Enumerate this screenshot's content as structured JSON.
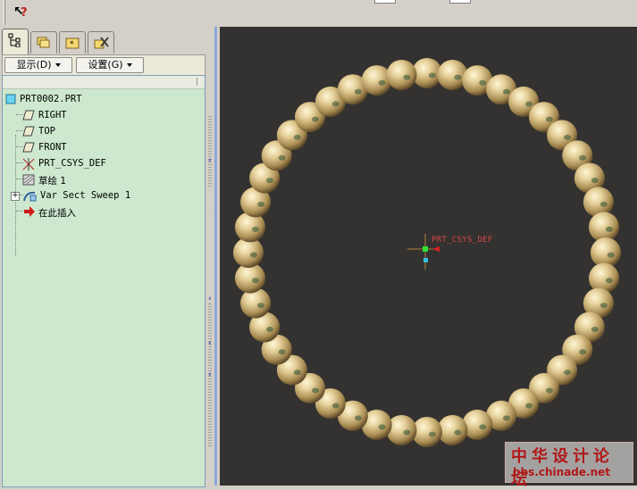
{
  "toolbar": {
    "help_icon": "context-help-icon"
  },
  "tabs": [
    {
      "name": "model-tree-icon",
      "active": true
    },
    {
      "name": "folder-browser-icon",
      "active": false
    },
    {
      "name": "favorites-icon",
      "active": false
    },
    {
      "name": "connections-icon",
      "active": false
    }
  ],
  "buttons": {
    "display_label": "显示(D)",
    "settings_label": "设置(G)"
  },
  "tree": {
    "root": "PRT0002.PRT",
    "items": [
      {
        "label": "RIGHT",
        "icon": "datum-plane-icon"
      },
      {
        "label": "TOP",
        "icon": "datum-plane-icon"
      },
      {
        "label": "FRONT",
        "icon": "datum-plane-icon"
      },
      {
        "label": "PRT_CSYS_DEF",
        "icon": "coordinate-system-icon"
      },
      {
        "label": "草绘 1",
        "icon": "sketch-icon"
      },
      {
        "label": "Var Sect Sweep 1",
        "icon": "sweep-feature-icon"
      },
      {
        "label": "在此插入",
        "icon": "insert-here-arrow-icon"
      }
    ]
  },
  "viewport": {
    "csys_label": "PRT_CSYS_DEF",
    "background": "#343230",
    "bead_count": 44
  },
  "watermark": {
    "chinese": "中华设计论坛",
    "url": "bbs.chinade.net"
  }
}
